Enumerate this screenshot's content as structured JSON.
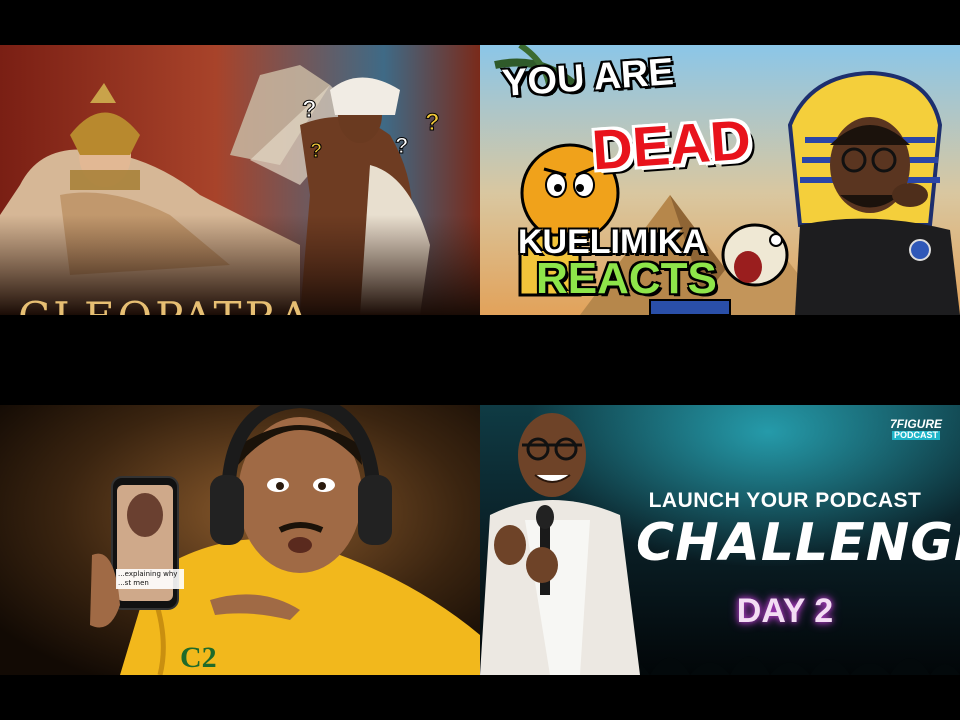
{
  "thumbnails": [
    {
      "title_text": "CLEOPATRA"
    },
    {
      "line1": "YOU ARE",
      "line2": "DEAD",
      "badge_line1": "KUELIMIKA",
      "badge_line2": "REACTS"
    },
    {
      "phone_caption": "...explaining why ...st men"
    },
    {
      "logo_line1": "7FIGURE",
      "logo_line2": "PODCAST",
      "line1": "LAUNCH YOUR PODCAST",
      "line2": "CHALLENGE",
      "line3": "DAY 2"
    }
  ],
  "colors": {
    "page_bg": "#000000",
    "cleopatra_title": "#e7bf73",
    "dead_red": "#e8131c",
    "reacts_green": "#8ee54a",
    "podcast_teal": "#1fb5c9",
    "hoodie_yellow": "#f2b81c"
  }
}
